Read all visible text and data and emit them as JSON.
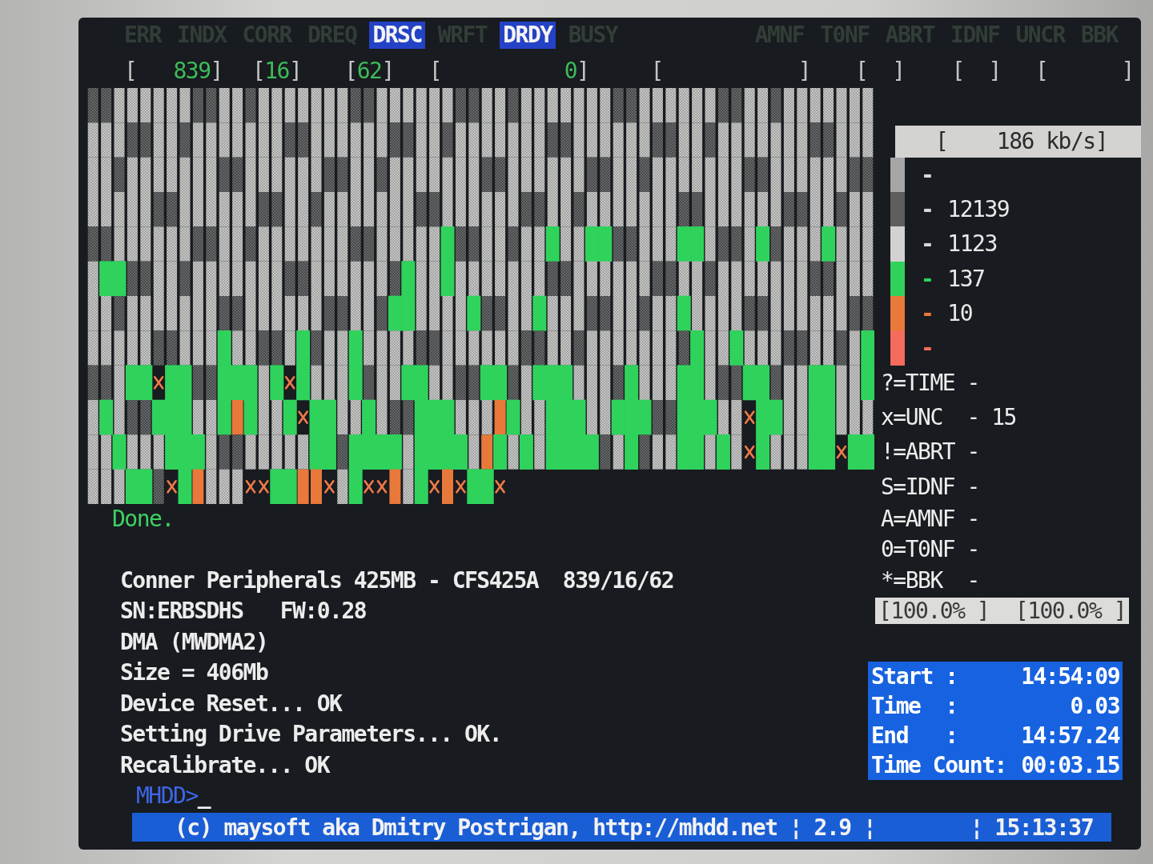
{
  "status_flags": [
    {
      "label": "ERR",
      "lit": false
    },
    {
      "label": "INDX",
      "lit": false
    },
    {
      "label": "CORR",
      "lit": false
    },
    {
      "label": "DREQ",
      "lit": false
    },
    {
      "label": "DRSC",
      "lit": true
    },
    {
      "label": "WRFT",
      "lit": false
    },
    {
      "label": "DRDY",
      "lit": true
    },
    {
      "label": "BUSY",
      "lit": false
    }
  ],
  "error_flags": [
    {
      "label": "AMNF",
      "lit": false
    },
    {
      "label": "T0NF",
      "lit": false
    },
    {
      "label": "ABRT",
      "lit": false
    },
    {
      "label": "IDNF",
      "lit": false
    },
    {
      "label": "UNCR",
      "lit": false
    },
    {
      "label": "BBK",
      "lit": false
    }
  ],
  "position_fields": [
    {
      "open": "[",
      "value": "839",
      "close": "]"
    },
    {
      "open": "[",
      "value": "16",
      "close": "]"
    },
    {
      "open": "[",
      "value": "62",
      "close": "]"
    },
    {
      "open": "[",
      "value": "0",
      "close": "]"
    },
    {
      "open": "[",
      "close": "]"
    },
    {
      "open": "[",
      "close": "]"
    },
    {
      "open": "[",
      "close": "]"
    },
    {
      "open": "[",
      "close": "]"
    }
  ],
  "scan_status": "Done.",
  "speed": {
    "reading": "[    186 kb/s]"
  },
  "speed_legend": [
    {
      "kind": "shade",
      "color": "#a6a6a6",
      "dash": "-"
    },
    {
      "kind": "shade",
      "color": "#5e5e5e",
      "dash": "-",
      "count": "12139"
    },
    {
      "kind": "shade",
      "color": "#d2d2d2",
      "dash": "-",
      "count": "1123"
    },
    {
      "kind": "colored",
      "color": "#2fd35c",
      "dash": "-",
      "count": "137"
    },
    {
      "kind": "colored",
      "color": "#e8793a",
      "dash": "-",
      "count": "10"
    },
    {
      "kind": "colored",
      "color": "#f56b5c",
      "dash": "-"
    }
  ],
  "error_legend": [
    "?=TIME -",
    "x=UNC  - 15",
    "!=ABRT -",
    "S=IDNF -",
    "A=AMNF -",
    "0=T0NF -",
    "*=BBK  -"
  ],
  "percentages": [
    "[100.0% ]",
    "[100.0% ]"
  ],
  "timing": [
    {
      "label": "Start :",
      "value": "14:54:09"
    },
    {
      "label": "Time  :",
      "value": "0.03"
    },
    {
      "label": "End   :",
      "value": "14:57.24"
    },
    {
      "label": "Time Count:",
      "value": "00:03.15"
    }
  ],
  "console": {
    "lines": [
      "Conner Peripherals 425MB - CFS425A  839/16/62",
      "SN:ERBSDHS   FW:0.28",
      "DMA (MWDMA2)",
      "Size = 406Mb",
      "Device Reset... OK",
      "Setting Drive Parameters... OK.",
      "Recalibrate... OK"
    ],
    "prompt": "MHDD>",
    "cursor": "_"
  },
  "status_bar": {
    "left": "(c) maysoft aka Dmitry Postrigan, http://mhdd.net ¦ 2.9 ¦",
    "right": "¦ 15:13:37"
  }
}
